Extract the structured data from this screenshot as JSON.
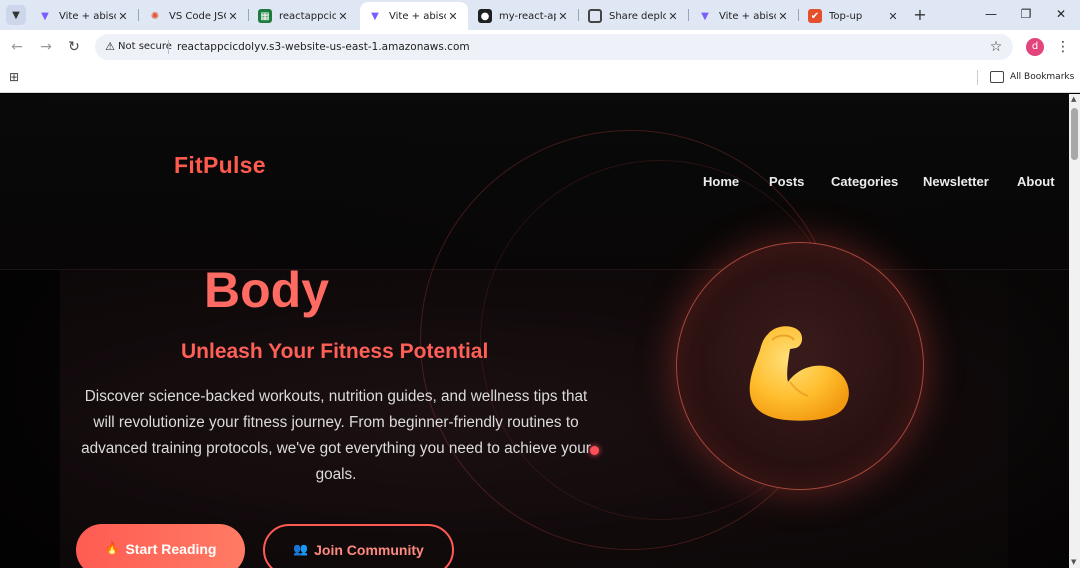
{
  "browser": {
    "tabs": [
      {
        "label": "Vite + abisola",
        "icon": "vite-icon"
      },
      {
        "label": "VS Code JSON",
        "icon": "vscode-icon"
      },
      {
        "label": "reactappcicd",
        "icon": "spreadsheet-icon"
      },
      {
        "label": "Vite + abisola",
        "icon": "vite-icon",
        "active": true
      },
      {
        "label": "my-react-app",
        "icon": "github-icon"
      },
      {
        "label": "Share deploy",
        "icon": "share-icon"
      },
      {
        "label": "Vite + abisola",
        "icon": "vite-icon"
      },
      {
        "label": "Top-up",
        "icon": "topup-icon"
      }
    ],
    "security_label": "Not secure",
    "url": "reactappcicdolyv.s3-website-us-east-1.amazonaws.com",
    "profile_initial": "d",
    "bookmarks_label": "All Bookmarks"
  },
  "site": {
    "logo": "FitPulse",
    "nav": [
      "Home",
      "Posts",
      "Categories",
      "Newsletter",
      "About"
    ],
    "hero": {
      "title": "Body",
      "subtitle": "Unleash Your Fitness Potential",
      "description": "Discover science-backed workouts, nutrition guides, and wellness tips that will revolutionize your fitness journey. From beginner-friendly routines to advanced training protocols, we've got everything you need to achieve your goals.",
      "primary_button": "Start Reading",
      "primary_icon": "🔥",
      "secondary_button": "Join Community",
      "secondary_icon": "👥"
    }
  },
  "colors": {
    "accent": "#ff5a4e",
    "background": "#000000",
    "tab_strip": "#dfe6f4"
  }
}
